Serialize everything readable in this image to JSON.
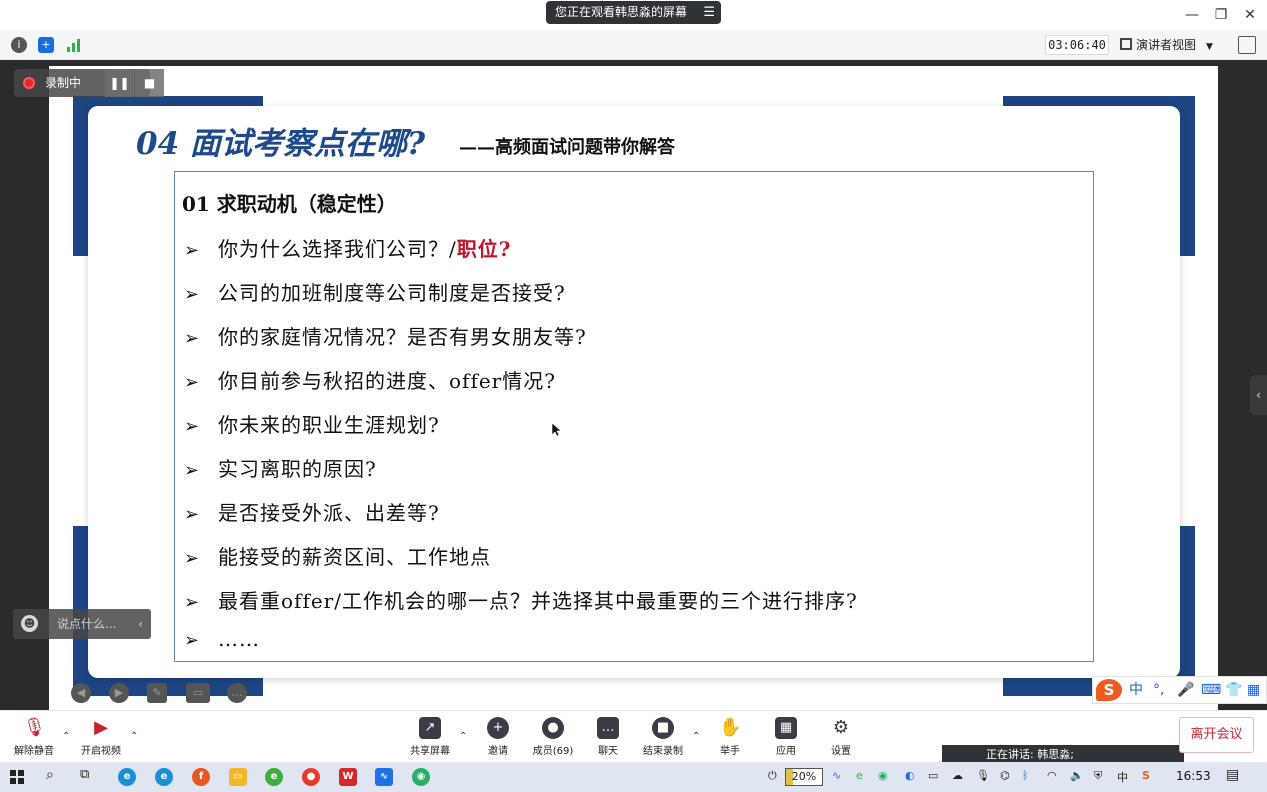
{
  "window": {
    "share_banner": "您正在观看韩思淼的屏幕",
    "minimize_icon": "minimize-icon",
    "restore_icon": "restore-icon",
    "close_icon": "close-icon"
  },
  "infobar": {
    "timer": "03:06:40",
    "view_mode": "演讲者视图",
    "icons": [
      "info-icon",
      "shield-icon",
      "signal-icon"
    ]
  },
  "recording": {
    "label": "录制中",
    "pause_icon": "pause-icon",
    "stop_icon": "stop-icon"
  },
  "chat": {
    "placeholder": "说点什么..."
  },
  "slide": {
    "heading": "04 面试考察点在哪?",
    "subheading": "——高频面试问题带你解答",
    "box_title": "01 求职动机（稳定性）",
    "bullet": "➢",
    "questions": [
      {
        "text": "你为什么选择我们公司？/",
        "highlight": "职位?"
      },
      {
        "text": "公司的加班制度等公司制度是否接受?",
        "highlight": ""
      },
      {
        "text": "你的家庭情况情况？是否有男女朋友等?",
        "highlight": ""
      },
      {
        "text": "你目前参与秋招的进度、offer情况?",
        "highlight": ""
      },
      {
        "text": "你未来的职业生涯规划?",
        "highlight": ""
      },
      {
        "text": "实习离职的原因?",
        "highlight": ""
      },
      {
        "text": "是否接受外派、出差等?",
        "highlight": ""
      },
      {
        "text": "能接受的薪资区间、工作地点",
        "highlight": ""
      },
      {
        "text": "最看重offer/工作机会的哪一点？并选择其中最重要的三个进行排序?",
        "highlight": ""
      },
      {
        "text": "……",
        "highlight": ""
      }
    ]
  },
  "ime": {
    "logo": "S",
    "mode": "中",
    "punct": "°,"
  },
  "controls": {
    "mute": "解除静音",
    "video": "开启视频",
    "share": "共享屏幕",
    "invite": "邀请",
    "members": "成员(69)",
    "chat": "聊天",
    "stop_record": "结束录制",
    "raise_hand": "举手",
    "apps": "应用",
    "settings": "设置",
    "leave": "离开会议",
    "speaking": "正在讲话: 韩思淼;"
  },
  "taskbar": {
    "battery": "20%",
    "ime_indicator": "中",
    "clock": "16:53"
  },
  "colors": {
    "accent_blue": "#1e4a8a",
    "highlight_red": "#c0142a",
    "leave_red": "#d1262f"
  }
}
